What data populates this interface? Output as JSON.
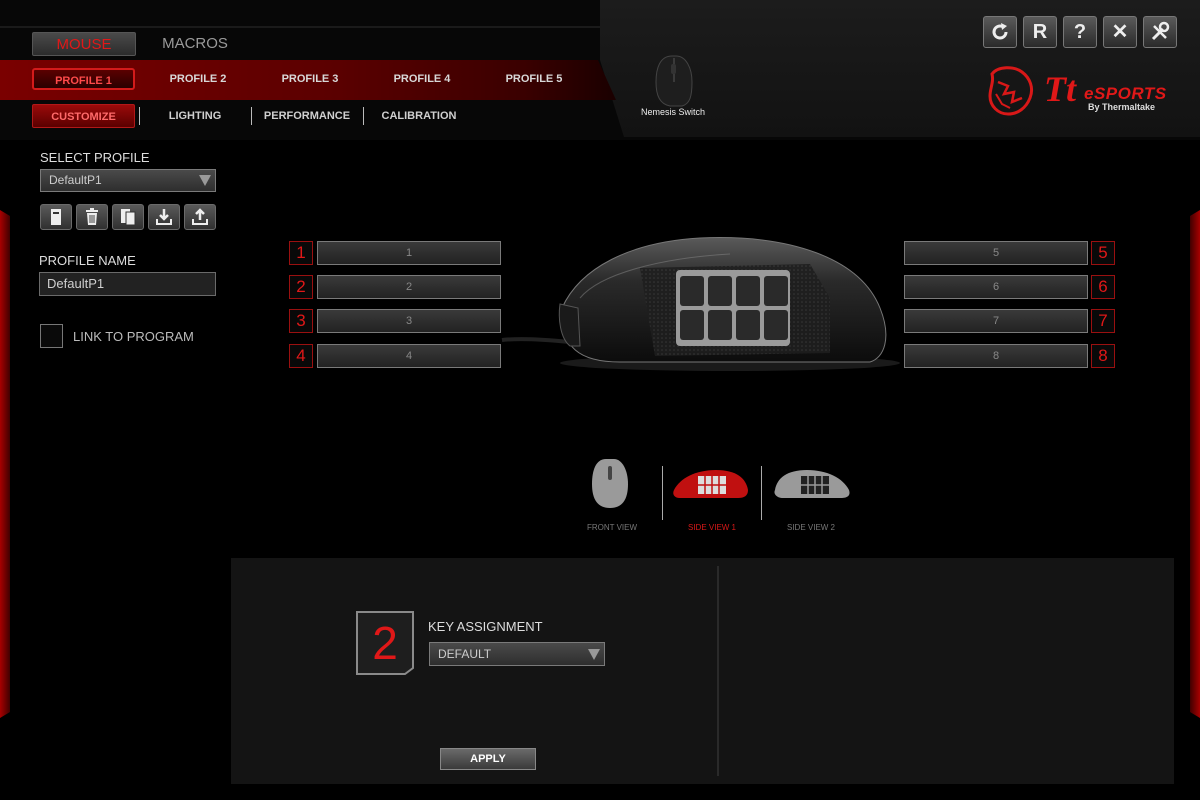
{
  "main_tabs": {
    "mouse": "MOUSE",
    "macros": "MACROS"
  },
  "profile_tabs": [
    "PROFILE 1",
    "PROFILE 2",
    "PROFILE 3",
    "PROFILE 4",
    "PROFILE 5"
  ],
  "sub_tabs": [
    "CUSTOMIZE",
    "LIGHTING",
    "PERFORMANCE",
    "CALIBRATION"
  ],
  "device": {
    "name": "Nemesis Switch"
  },
  "window_buttons": [
    {
      "icon": "refresh-icon"
    },
    {
      "icon": "reset-icon",
      "label": "R"
    },
    {
      "icon": "help-icon",
      "label": "?"
    },
    {
      "icon": "close-icon",
      "label": "✕"
    },
    {
      "icon": "tools-icon"
    }
  ],
  "brand": {
    "tt": "Tt",
    "esports": "eSPORTS",
    "by": "By Thermaltake"
  },
  "left_panel": {
    "select_profile_label": "SELECT PROFILE",
    "selected_profile": "DefaultP1",
    "toolbar_icons": [
      "save-icon",
      "delete-icon",
      "copy-icon",
      "import-icon",
      "export-icon"
    ],
    "profile_name_label": "PROFILE NAME",
    "profile_name_value": "DefaultP1",
    "link_to_program_label": "LINK TO PROGRAM"
  },
  "buttons_left": [
    {
      "num": "1",
      "value": "1"
    },
    {
      "num": "2",
      "value": "2"
    },
    {
      "num": "3",
      "value": "3"
    },
    {
      "num": "4",
      "value": "4"
    }
  ],
  "buttons_right": [
    {
      "num": "5",
      "value": "5"
    },
    {
      "num": "6",
      "value": "6"
    },
    {
      "num": "7",
      "value": "7"
    },
    {
      "num": "8",
      "value": "8"
    }
  ],
  "views": [
    {
      "label": "FRONT VIEW",
      "active": false
    },
    {
      "label": "SIDE VIEW 1",
      "active": true
    },
    {
      "label": "SIDE VIEW 2",
      "active": false
    }
  ],
  "assignment": {
    "selected_key": "2",
    "label": "KEY ASSIGNMENT",
    "value": "DEFAULT",
    "apply": "APPLY"
  },
  "colors": {
    "accent": "#e01818",
    "panel": "#141414"
  }
}
